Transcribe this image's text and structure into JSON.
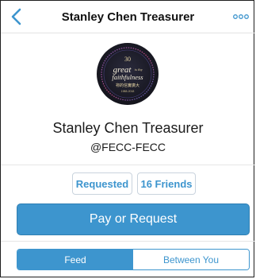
{
  "navbar": {
    "title": "Stanley Chen Treasurer",
    "back_icon": "chevron-left-icon",
    "more_icon": "ellipsis-icon"
  },
  "avatar": {
    "badge_top": "30",
    "badge_line1": "great",
    "badge_line2": "is thy",
    "badge_line3": "faithfulness",
    "badge_chinese": "祢的信實廣大",
    "badge_bottom": "1988-2018"
  },
  "profile": {
    "name": "Stanley Chen Treasurer",
    "handle": "@FECC-FECC"
  },
  "actions": {
    "requested_label": "Requested",
    "friends_label": "16 Friends",
    "pay_label": "Pay or Request"
  },
  "tabs": [
    {
      "label": "Feed"
    },
    {
      "label": "Between You"
    }
  ],
  "colors": {
    "accent": "#3d95ce",
    "badge_dark": "#1a1a24"
  }
}
